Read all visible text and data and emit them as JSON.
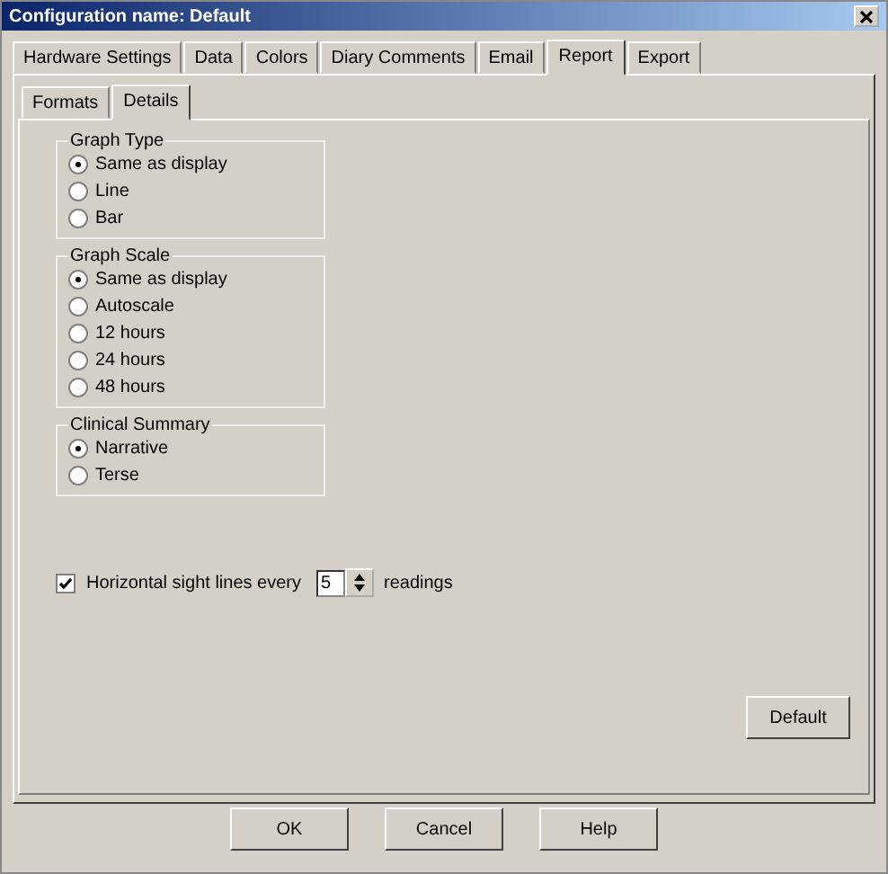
{
  "window": {
    "title": "Configuration name: Default"
  },
  "tabs": [
    {
      "label": "Hardware Settings",
      "selected": false
    },
    {
      "label": "Data",
      "selected": false
    },
    {
      "label": "Colors",
      "selected": false
    },
    {
      "label": "Diary Comments",
      "selected": false
    },
    {
      "label": "Email",
      "selected": false
    },
    {
      "label": "Report",
      "selected": true
    },
    {
      "label": "Export",
      "selected": false
    }
  ],
  "subtabs": [
    {
      "label": "Formats",
      "selected": false
    },
    {
      "label": "Details",
      "selected": true
    }
  ],
  "groups": [
    {
      "title": "Graph Type",
      "options": [
        {
          "label": "Same as display",
          "selected": true
        },
        {
          "label": "Line",
          "selected": false
        },
        {
          "label": "Bar",
          "selected": false
        }
      ]
    },
    {
      "title": "Graph Scale",
      "options": [
        {
          "label": "Same as display",
          "selected": true
        },
        {
          "label": "Autoscale",
          "selected": false
        },
        {
          "label": "12 hours",
          "selected": false
        },
        {
          "label": "24 hours",
          "selected": false
        },
        {
          "label": "48 hours",
          "selected": false
        }
      ]
    },
    {
      "title": "Clinical Summary",
      "options": [
        {
          "label": "Narrative",
          "selected": true
        },
        {
          "label": "Terse",
          "selected": false
        }
      ]
    }
  ],
  "sight_lines": {
    "label": "Horizontal sight lines every",
    "checked": true,
    "value": "5",
    "suffix": "readings"
  },
  "default_button": "Default",
  "buttons": [
    "OK",
    "Cancel",
    "Help"
  ]
}
